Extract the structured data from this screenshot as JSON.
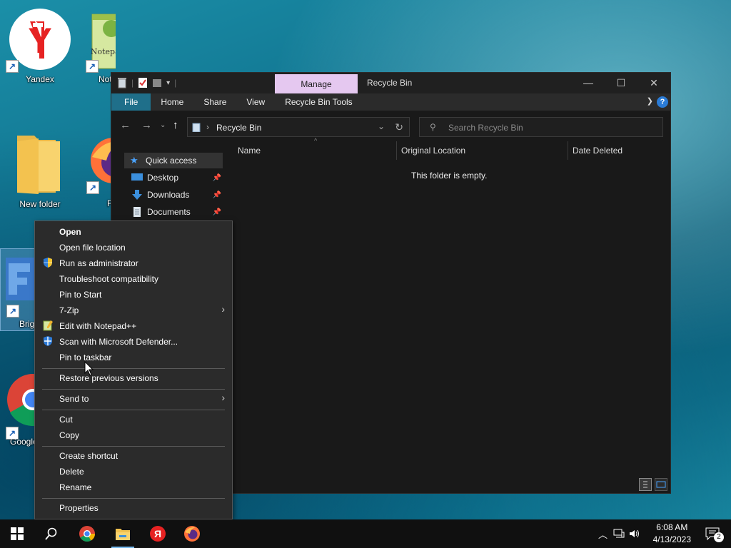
{
  "desktop": {
    "icons": [
      {
        "label": "Yandex",
        "icon": "yandex-icon"
      },
      {
        "label": "Not",
        "icon": "notepad-plus-plus-icon"
      },
      {
        "label": "New folder",
        "icon": "folder-icon"
      },
      {
        "label": "F",
        "icon": "firefox-icon"
      },
      {
        "label": "Brig",
        "icon": "app-icon"
      },
      {
        "label": "Google",
        "icon": "chrome-icon"
      }
    ]
  },
  "explorer": {
    "manage_tab": "Manage",
    "title": "Recycle Bin",
    "ribbon": {
      "file": "File",
      "home": "Home",
      "share": "Share",
      "view": "View",
      "tools": "Recycle Bin Tools",
      "help": "?"
    },
    "address": "Recycle Bin",
    "search_placeholder": "Search Recycle Bin",
    "sidebar": [
      {
        "label": "Quick access",
        "icon": "star-icon"
      },
      {
        "label": "Desktop",
        "icon": "desktop-icon"
      },
      {
        "label": "Downloads",
        "icon": "download-icon"
      },
      {
        "label": "Documents",
        "icon": "documents-icon"
      }
    ],
    "columns": [
      "Name",
      "Original Location",
      "Date Deleted"
    ],
    "empty_message": "This folder is empty."
  },
  "context_menu": {
    "items": [
      {
        "label": "Open"
      },
      {
        "label": "Open file location"
      },
      {
        "label": "Run as administrator",
        "icon": "uac-shield-icon"
      },
      {
        "label": "Troubleshoot compatibility"
      },
      {
        "label": "Pin to Start"
      },
      {
        "label": "7-Zip"
      },
      {
        "label": "Edit with Notepad++",
        "icon": "notepad-plus-plus-icon"
      },
      {
        "label": "Scan with Microsoft Defender...",
        "icon": "defender-icon"
      },
      {
        "label": "Pin to taskbar"
      },
      {
        "label": "Restore previous versions"
      },
      {
        "label": "Send to"
      },
      {
        "label": "Cut"
      },
      {
        "label": "Copy"
      },
      {
        "label": "Create shortcut"
      },
      {
        "label": "Delete"
      },
      {
        "label": "Rename"
      },
      {
        "label": "Properties"
      }
    ]
  },
  "taskbar": {
    "apps": [
      "start-icon",
      "search-icon",
      "chrome-icon",
      "file-explorer-icon",
      "yandex-icon",
      "firefox-icon"
    ],
    "time": "6:08 AM",
    "date": "4/13/2023",
    "notification_count": "2"
  }
}
